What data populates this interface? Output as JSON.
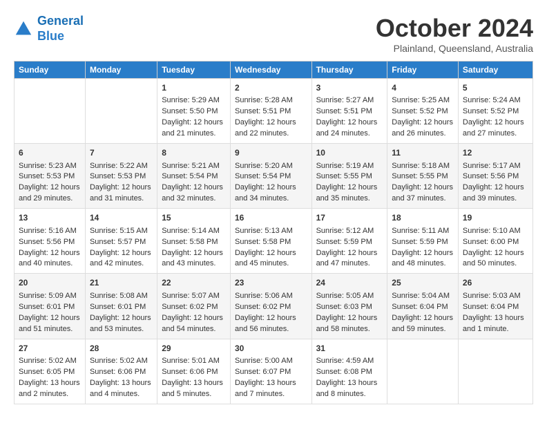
{
  "header": {
    "logo_line1": "General",
    "logo_line2": "Blue",
    "month_title": "October 2024",
    "location": "Plainland, Queensland, Australia"
  },
  "weekdays": [
    "Sunday",
    "Monday",
    "Tuesday",
    "Wednesday",
    "Thursday",
    "Friday",
    "Saturday"
  ],
  "weeks": [
    [
      {
        "day": "",
        "info": ""
      },
      {
        "day": "",
        "info": ""
      },
      {
        "day": "1",
        "info": "Sunrise: 5:29 AM\nSunset: 5:50 PM\nDaylight: 12 hours and 21 minutes."
      },
      {
        "day": "2",
        "info": "Sunrise: 5:28 AM\nSunset: 5:51 PM\nDaylight: 12 hours and 22 minutes."
      },
      {
        "day": "3",
        "info": "Sunrise: 5:27 AM\nSunset: 5:51 PM\nDaylight: 12 hours and 24 minutes."
      },
      {
        "day": "4",
        "info": "Sunrise: 5:25 AM\nSunset: 5:52 PM\nDaylight: 12 hours and 26 minutes."
      },
      {
        "day": "5",
        "info": "Sunrise: 5:24 AM\nSunset: 5:52 PM\nDaylight: 12 hours and 27 minutes."
      }
    ],
    [
      {
        "day": "6",
        "info": "Sunrise: 5:23 AM\nSunset: 5:53 PM\nDaylight: 12 hours and 29 minutes."
      },
      {
        "day": "7",
        "info": "Sunrise: 5:22 AM\nSunset: 5:53 PM\nDaylight: 12 hours and 31 minutes."
      },
      {
        "day": "8",
        "info": "Sunrise: 5:21 AM\nSunset: 5:54 PM\nDaylight: 12 hours and 32 minutes."
      },
      {
        "day": "9",
        "info": "Sunrise: 5:20 AM\nSunset: 5:54 PM\nDaylight: 12 hours and 34 minutes."
      },
      {
        "day": "10",
        "info": "Sunrise: 5:19 AM\nSunset: 5:55 PM\nDaylight: 12 hours and 35 minutes."
      },
      {
        "day": "11",
        "info": "Sunrise: 5:18 AM\nSunset: 5:55 PM\nDaylight: 12 hours and 37 minutes."
      },
      {
        "day": "12",
        "info": "Sunrise: 5:17 AM\nSunset: 5:56 PM\nDaylight: 12 hours and 39 minutes."
      }
    ],
    [
      {
        "day": "13",
        "info": "Sunrise: 5:16 AM\nSunset: 5:56 PM\nDaylight: 12 hours and 40 minutes."
      },
      {
        "day": "14",
        "info": "Sunrise: 5:15 AM\nSunset: 5:57 PM\nDaylight: 12 hours and 42 minutes."
      },
      {
        "day": "15",
        "info": "Sunrise: 5:14 AM\nSunset: 5:58 PM\nDaylight: 12 hours and 43 minutes."
      },
      {
        "day": "16",
        "info": "Sunrise: 5:13 AM\nSunset: 5:58 PM\nDaylight: 12 hours and 45 minutes."
      },
      {
        "day": "17",
        "info": "Sunrise: 5:12 AM\nSunset: 5:59 PM\nDaylight: 12 hours and 47 minutes."
      },
      {
        "day": "18",
        "info": "Sunrise: 5:11 AM\nSunset: 5:59 PM\nDaylight: 12 hours and 48 minutes."
      },
      {
        "day": "19",
        "info": "Sunrise: 5:10 AM\nSunset: 6:00 PM\nDaylight: 12 hours and 50 minutes."
      }
    ],
    [
      {
        "day": "20",
        "info": "Sunrise: 5:09 AM\nSunset: 6:01 PM\nDaylight: 12 hours and 51 minutes."
      },
      {
        "day": "21",
        "info": "Sunrise: 5:08 AM\nSunset: 6:01 PM\nDaylight: 12 hours and 53 minutes."
      },
      {
        "day": "22",
        "info": "Sunrise: 5:07 AM\nSunset: 6:02 PM\nDaylight: 12 hours and 54 minutes."
      },
      {
        "day": "23",
        "info": "Sunrise: 5:06 AM\nSunset: 6:02 PM\nDaylight: 12 hours and 56 minutes."
      },
      {
        "day": "24",
        "info": "Sunrise: 5:05 AM\nSunset: 6:03 PM\nDaylight: 12 hours and 58 minutes."
      },
      {
        "day": "25",
        "info": "Sunrise: 5:04 AM\nSunset: 6:04 PM\nDaylight: 12 hours and 59 minutes."
      },
      {
        "day": "26",
        "info": "Sunrise: 5:03 AM\nSunset: 6:04 PM\nDaylight: 13 hours and 1 minute."
      }
    ],
    [
      {
        "day": "27",
        "info": "Sunrise: 5:02 AM\nSunset: 6:05 PM\nDaylight: 13 hours and 2 minutes."
      },
      {
        "day": "28",
        "info": "Sunrise: 5:02 AM\nSunset: 6:06 PM\nDaylight: 13 hours and 4 minutes."
      },
      {
        "day": "29",
        "info": "Sunrise: 5:01 AM\nSunset: 6:06 PM\nDaylight: 13 hours and 5 minutes."
      },
      {
        "day": "30",
        "info": "Sunrise: 5:00 AM\nSunset: 6:07 PM\nDaylight: 13 hours and 7 minutes."
      },
      {
        "day": "31",
        "info": "Sunrise: 4:59 AM\nSunset: 6:08 PM\nDaylight: 13 hours and 8 minutes."
      },
      {
        "day": "",
        "info": ""
      },
      {
        "day": "",
        "info": ""
      }
    ]
  ]
}
